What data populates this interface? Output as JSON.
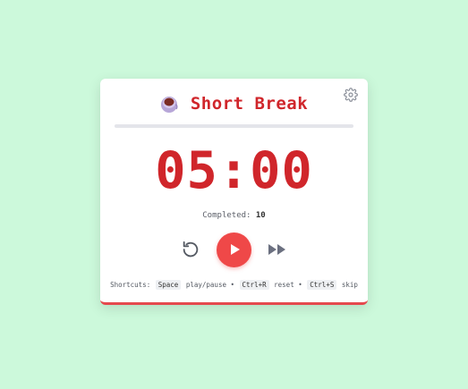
{
  "timer": {
    "title": "Short Break",
    "time": "05:00",
    "completed_label": "Completed:",
    "completed_count": "10",
    "progress": 0
  },
  "icons": {
    "mode": "coffee-cup-icon",
    "settings": "gear-icon",
    "reset": "reset-icon",
    "play": "play-icon",
    "skip": "skip-icon"
  },
  "shortcuts": {
    "prefix": "Shortcuts:",
    "items": [
      {
        "key": "Space",
        "action": "play/pause"
      },
      {
        "key": "Ctrl+R",
        "action": "reset"
      },
      {
        "key": "Ctrl+S",
        "action": "skip"
      }
    ],
    "separator": "•"
  },
  "colors": {
    "background": "#ccf9db",
    "accent": "#e5484d",
    "title": "#d0262b"
  }
}
